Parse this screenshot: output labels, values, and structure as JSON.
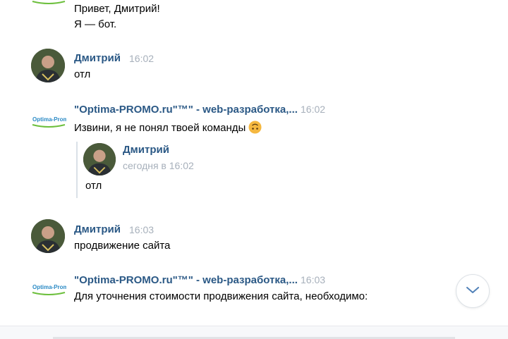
{
  "messages": [
    {
      "lines": [
        "Привет, Дмитрий!",
        "Я — бот."
      ]
    },
    {
      "author": "Дмитрий",
      "time": "16:02",
      "text": "отл"
    },
    {
      "author": "\"Optima-PROMO.ru\"™\" - web-разработка,...",
      "time": "16:02",
      "text": "Извини, я не понял твоей команды",
      "emoji": "upside-down-face-emoji",
      "quote": {
        "author": "Дмитрий",
        "date": "сегодня в 16:02",
        "text": "отл"
      }
    },
    {
      "author": "Дмитрий",
      "time": "16:03",
      "text": "продвижение сайта"
    },
    {
      "author": "\"Optima-PROMO.ru\"™\" - web-разработка,...",
      "time": "16:03",
      "text": "Для уточнения стоимости продвижения сайта, необходимо:"
    }
  ],
  "bot_logo_text": "Optima-Promo",
  "scroll_button_icon": "chevron-down-icon",
  "colors": {
    "name": "#2a5885",
    "time": "#a7b0bb",
    "accent": "#5181b8",
    "emoji": "#f5b840"
  }
}
